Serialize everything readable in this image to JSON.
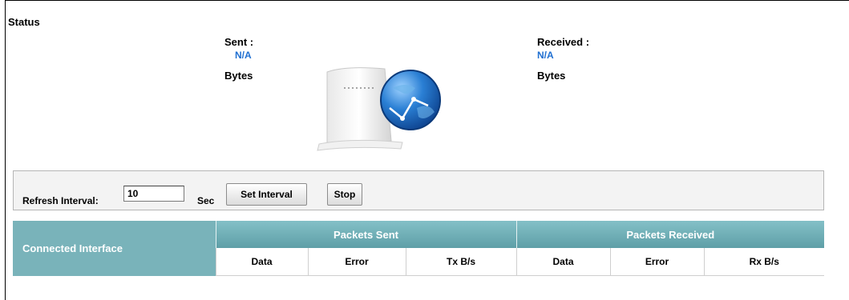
{
  "status": {
    "title": "Status",
    "sent": {
      "label": "Sent :",
      "value": "N/A",
      "unit": "Bytes"
    },
    "received": {
      "label": "Received :",
      "value": "N/A",
      "unit": "Bytes"
    }
  },
  "controls": {
    "refresh_label": "Refresh Interval:",
    "refresh_value": "10",
    "unit": "Sec",
    "set_interval": "Set Interval",
    "stop": "Stop"
  },
  "table": {
    "connected_interface": "Connected Interface",
    "packets_sent": "Packets Sent",
    "packets_received": "Packets Received",
    "sent_cols": [
      "Data",
      "Error",
      "Tx B/s"
    ],
    "recv_cols": [
      "Data",
      "Error",
      "Rx B/s"
    ]
  },
  "colors": {
    "header_teal": "#79b3ba",
    "value_blue": "#1f6fd1"
  }
}
